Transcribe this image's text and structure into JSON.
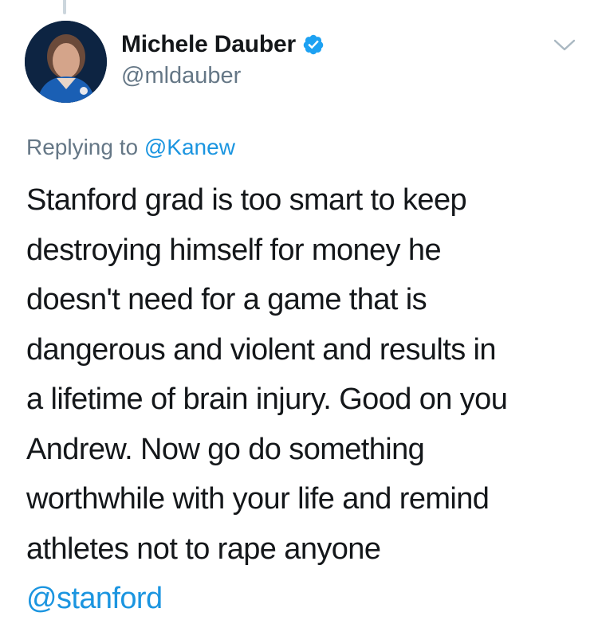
{
  "tweet": {
    "author": {
      "display_name": "Michele Dauber",
      "handle": "@mldauber",
      "verified": true,
      "avatar_icon": "user-avatar-photo"
    },
    "reply_context": {
      "prefix": "Replying to ",
      "mention": "@Kanew"
    },
    "text_lines": [
      "Stanford grad is too smart to keep",
      "destroying himself for money he",
      "doesn't need for a game that is",
      "dangerous and violent and results in",
      "a lifetime of brain injury. Good on you",
      "Andrew. Now go do something",
      "worthwhile with your life and remind",
      "athletes not to rape anyone"
    ],
    "trailing_mention": "@stanford",
    "menu_icon": "chevron-down-icon"
  },
  "colors": {
    "text": "#14171a",
    "secondary": "#657786",
    "link": "#1b95e0",
    "verified": "#1da1f2",
    "thread_line": "#ccd6dd"
  }
}
